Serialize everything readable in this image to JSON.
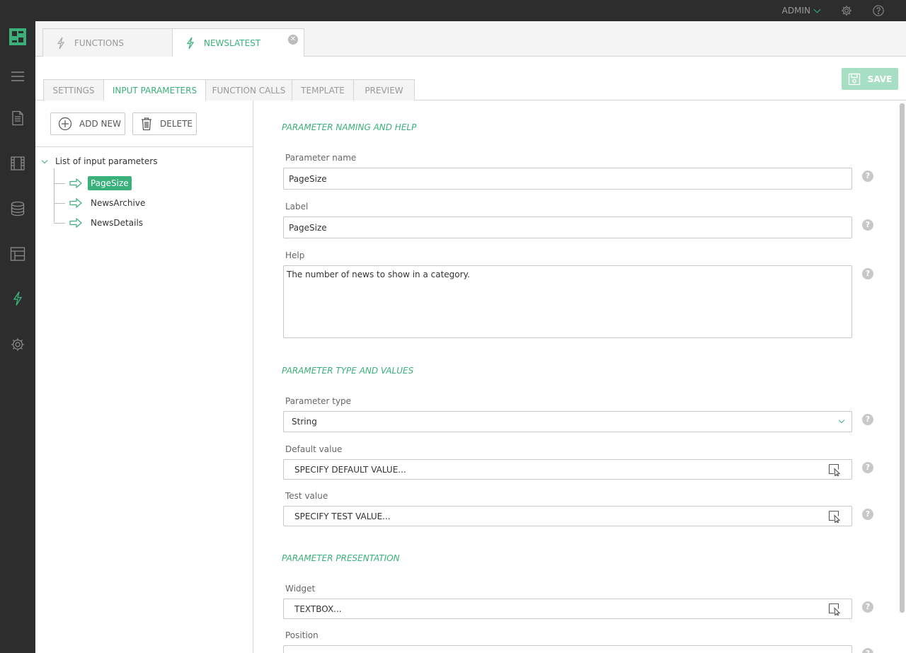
{
  "topbar": {
    "user_label": "ADMIN",
    "icons": [
      "gear-icon",
      "help-icon"
    ]
  },
  "rail": {
    "icons": [
      "logo-icon",
      "menu-icon",
      "content-icon",
      "media-icon",
      "data-icon",
      "layout-icon",
      "functions-icon",
      "settings-icon"
    ],
    "active": "functions-icon"
  },
  "doc_tabs": [
    {
      "label": "FUNCTIONS",
      "active": false
    },
    {
      "label": "NEWSLATEST",
      "active": true
    }
  ],
  "sub_tabs": [
    {
      "label": "SETTINGS",
      "active": false
    },
    {
      "label": "INPUT PARAMETERS",
      "active": true
    },
    {
      "label": "FUNCTION CALLS",
      "active": false
    },
    {
      "label": "TEMPLATE",
      "active": false
    },
    {
      "label": "PREVIEW",
      "active": false
    }
  ],
  "save_label": "SAVE",
  "toolbar": {
    "add_label": "ADD NEW",
    "delete_label": "DELETE"
  },
  "tree": {
    "root_label": "List of input parameters",
    "items": [
      "PageSize",
      "NewsArchive",
      "NewsDetails"
    ],
    "selected": "PageSize"
  },
  "form": {
    "section1": "PARAMETER NAMING AND HELP",
    "name_label": "Parameter name",
    "name_value": "PageSize",
    "label_label": "Label",
    "label_value": "PageSize",
    "help_label": "Help",
    "help_value": "The number of news to show in a category.",
    "section2": "PARAMETER TYPE AND VALUES",
    "type_label": "Parameter type",
    "type_value": "String",
    "default_label": "Default value",
    "default_value": "SPECIFY DEFAULT VALUE...",
    "test_label": "Test value",
    "test_value": "SPECIFY TEST VALUE...",
    "section3": "PARAMETER PRESENTATION",
    "widget_label": "Widget",
    "widget_value": "TEXTBOX...",
    "position_label": "Position",
    "help_icon_glyph": "?"
  },
  "colors": {
    "accent": "#3ab07a",
    "rail_bg": "#2d2d2d",
    "save_bg": "#a7dfc4"
  }
}
